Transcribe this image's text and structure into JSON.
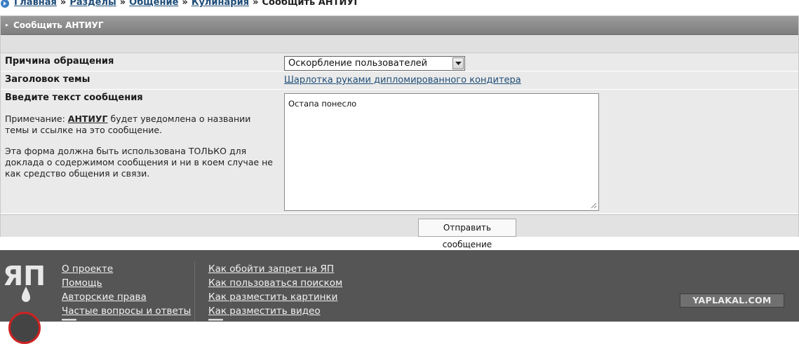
{
  "breadcrumb": {
    "items": [
      "Главная",
      "Разделы",
      "Общение",
      "Кулинария"
    ],
    "separator": "»",
    "current": "Сообщить АНТИУГ"
  },
  "panel": {
    "title": "Сообщить АНТИУГ",
    "reason_label": "Причина обращения",
    "reason_value": "Оскорбление пользователей",
    "topic_label": "Заголовок темы",
    "topic_link": "Шарлотка руками дипломированного кондитера",
    "message_label": "Введите текст сообщения",
    "note_prefix": "Примечание: ",
    "note_name": "АНТИУГ",
    "note_rest": " будет уведомлена о названии темы и ссылке на это сообщение.",
    "note2": "Эта форма должна быть использована ТОЛЬКО для доклада о содержимом сообщения и ни в коем случае не как средство общения и связи.",
    "message_value": "Остапа понесло",
    "submit_label": "Отправить сообщение"
  },
  "footer": {
    "col1": [
      "О проекте",
      "Помощь",
      "Авторские права",
      "Частые вопросы и ответы"
    ],
    "col2": [
      "Как обойти запрет на ЯП",
      "Как пользоваться поиском",
      "Как разместить картинки",
      "Как разместить видео"
    ],
    "wordmark": "YAPLAKAL.COM",
    "logo_text": "ЯП"
  },
  "colors": {
    "link": "#1f4d78",
    "header_gray": "#8c8c8c",
    "footer_bg": "#555555",
    "panel_bg": "#eaeaea"
  }
}
